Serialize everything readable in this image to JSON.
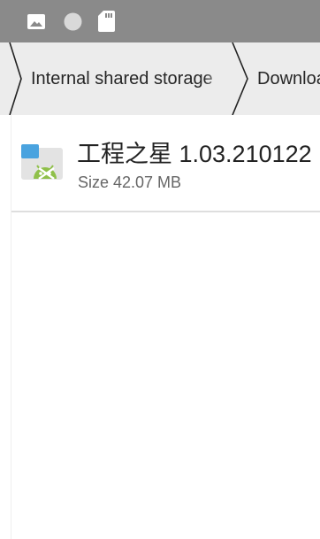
{
  "status_bar": {
    "icons": [
      "image-icon",
      "circle-icon",
      "sd-card-icon"
    ]
  },
  "breadcrumb": {
    "items": [
      {
        "label": "Internal shared storage"
      },
      {
        "label": "Download"
      }
    ]
  },
  "files": [
    {
      "name": "工程之星 1.03.210122",
      "size": "Size 42.07 MB",
      "icon": "apk-file-icon"
    }
  ]
}
